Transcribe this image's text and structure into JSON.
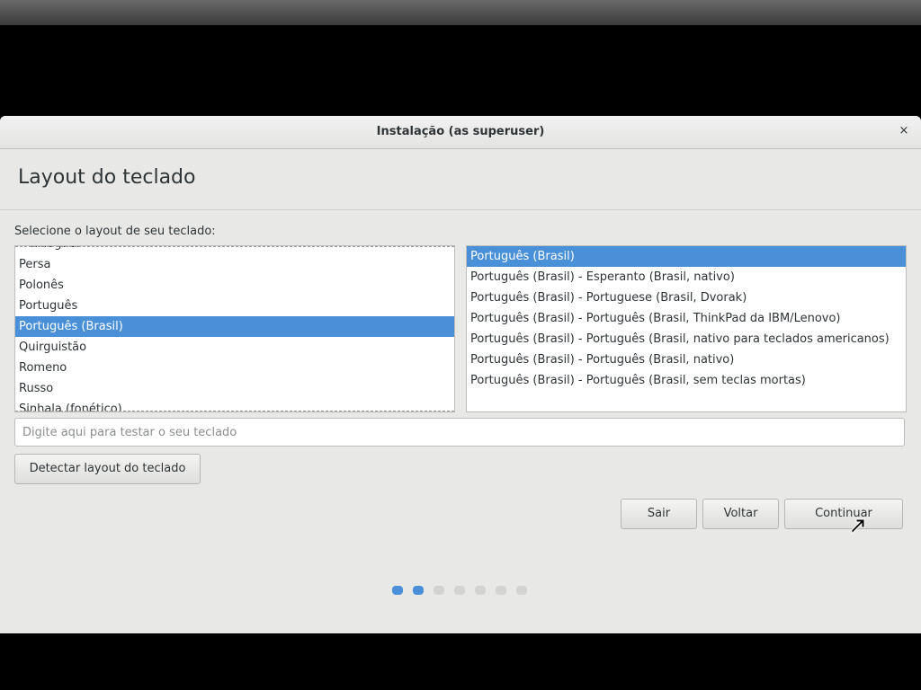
{
  "window": {
    "title": "Instalação (as superuser)",
    "close_glyph": "×"
  },
  "page": {
    "heading": "Layout do teclado",
    "prompt": "Selecione o layout de seu teclado:"
  },
  "layouts": {
    "items": [
      "Norueguês",
      "Persa",
      "Polonês",
      "Português",
      "Português (Brasil)",
      "Quirguistão",
      "Romeno",
      "Russo",
      "Sinhala (fonético)"
    ],
    "selected": "Português (Brasil)"
  },
  "variants": {
    "items": [
      "Português (Brasil)",
      "Português (Brasil) - Esperanto (Brasil, nativo)",
      "Português (Brasil) - Portuguese (Brasil, Dvorak)",
      "Português (Brasil) - Português (Brasil, ThinkPad da IBM/Lenovo)",
      "Português (Brasil) - Português (Brasil, nativo para teclados americanos)",
      "Português (Brasil) - Português (Brasil, nativo)",
      "Português (Brasil) - Português (Brasil, sem teclas mortas)"
    ],
    "selected": "Português (Brasil)"
  },
  "test_field": {
    "value": "",
    "placeholder": "Digite aqui para testar o seu teclado"
  },
  "buttons": {
    "detect": "Detectar layout do teclado",
    "quit": "Sair",
    "back": "Voltar",
    "continue": "Continuar"
  },
  "progress": {
    "total_steps": 7,
    "completed_steps": 2
  },
  "colors": {
    "accent": "#4a90d9",
    "window_bg": "#e8e8e7",
    "dot_inactive": "#d3d3d1"
  }
}
